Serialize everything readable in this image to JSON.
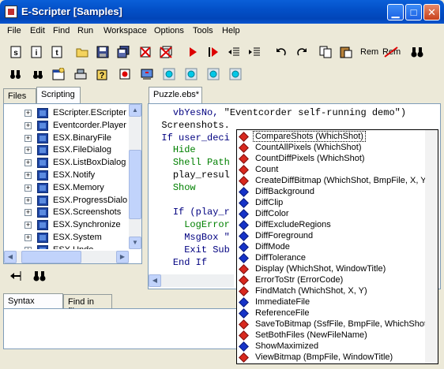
{
  "window": {
    "title": "E-Scripter [Samples]",
    "minimize_glyph": "▁",
    "maximize_glyph": "□",
    "close_glyph": "✕"
  },
  "menu": [
    "File",
    "Edit",
    "Find",
    "Run",
    "Workspace",
    "Options",
    "Tools",
    "Help"
  ],
  "toolbar": {
    "rem_label": "Rem",
    "unrem_label": "Rem"
  },
  "left_pane": {
    "tabs": [
      "Files",
      "Scripting"
    ],
    "active_tab": "Scripting",
    "tree_items": [
      "EScripter.EScripter",
      "Eventcorder.Player",
      "ESX.BinaryFile",
      "ESX.FileDialog",
      "ESX.ListBoxDialog",
      "ESX.Notify",
      "ESX.Memory",
      "ESX.ProgressDialog",
      "ESX.Screenshots",
      "ESX.Synchronize",
      "ESX.System",
      "ESX.Undo"
    ],
    "selected_item": "ESX.Screenshots"
  },
  "editor": {
    "tab_label": "Puzzle.ebs*",
    "lines": [
      {
        "indent": "    ",
        "parts": [
          {
            "t": "vbYesNo, ",
            "c": "nm"
          },
          {
            "t": "\"Eventcorder self-running demo\")",
            "c": "st"
          }
        ]
      },
      {
        "indent": "  ",
        "parts": [
          {
            "t": "Screenshots.",
            "c": "st"
          }
        ]
      },
      {
        "indent": "  ",
        "parts": [
          {
            "t": "If ",
            "c": "nm"
          },
          {
            "t": "user_deci",
            "c": "nm"
          }
        ]
      },
      {
        "indent": "    ",
        "parts": [
          {
            "t": "Hide",
            "c": "kw"
          }
        ]
      },
      {
        "indent": "    ",
        "parts": [
          {
            "t": "Shell Path",
            "c": "kw"
          }
        ]
      },
      {
        "indent": "    ",
        "parts": [
          {
            "t": "play_resul",
            "c": "st"
          }
        ]
      },
      {
        "indent": "    ",
        "parts": [
          {
            "t": "Show",
            "c": "kw"
          }
        ]
      },
      {
        "indent": "",
        "parts": [
          {
            "t": "",
            "c": "st"
          }
        ]
      },
      {
        "indent": "    ",
        "parts": [
          {
            "t": "If (play_r",
            "c": "nm"
          }
        ]
      },
      {
        "indent": "      ",
        "parts": [
          {
            "t": "LogError",
            "c": "kw"
          }
        ]
      },
      {
        "indent": "      ",
        "parts": [
          {
            "t": "MsgBox \"",
            "c": "nm"
          }
        ]
      },
      {
        "indent": "      ",
        "parts": [
          {
            "t": "Exit Sub",
            "c": "nm"
          }
        ]
      },
      {
        "indent": "    ",
        "parts": [
          {
            "t": "End If",
            "c": "nm"
          }
        ]
      }
    ]
  },
  "autocomplete": {
    "items": [
      {
        "label": "CompareShots (WhichShot)",
        "icon": "red"
      },
      {
        "label": "CountAllPixels (WhichShot)",
        "icon": "red"
      },
      {
        "label": "CountDiffPixels (WhichShot)",
        "icon": "red"
      },
      {
        "label": "Count",
        "icon": "red"
      },
      {
        "label": "CreateDiffBitmap (WhichShot, BmpFile, X, Y)",
        "icon": "red"
      },
      {
        "label": "DiffBackground",
        "icon": "blue"
      },
      {
        "label": "DiffClip",
        "icon": "blue"
      },
      {
        "label": "DiffColor",
        "icon": "blue"
      },
      {
        "label": "DiffExcludeRegions",
        "icon": "blue"
      },
      {
        "label": "DiffForeground",
        "icon": "blue"
      },
      {
        "label": "DiffMode",
        "icon": "blue"
      },
      {
        "label": "DiffTolerance",
        "icon": "blue"
      },
      {
        "label": "Display (WhichShot, WindowTitle)",
        "icon": "red"
      },
      {
        "label": "ErrorToStr (ErrorCode)",
        "icon": "red"
      },
      {
        "label": "FindMatch (WhichShot, X, Y)",
        "icon": "red"
      },
      {
        "label": "ImmediateFile",
        "icon": "blue"
      },
      {
        "label": "ReferenceFile",
        "icon": "blue"
      },
      {
        "label": "SaveToBitmap (SsfFile, BmpFile, WhichShot)",
        "icon": "red"
      },
      {
        "label": "SetBothFiles (NewFileName)",
        "icon": "red"
      },
      {
        "label": "ShowMaximized",
        "icon": "blue"
      },
      {
        "label": "ViewBitmap (BmpFile, WindowTitle)",
        "icon": "red"
      }
    ],
    "selected": "CompareShots (WhichShot)"
  },
  "bottom_pane": {
    "tabs": [
      "Syntax errors",
      "Find in files"
    ],
    "active_tab": "Syntax errors"
  }
}
